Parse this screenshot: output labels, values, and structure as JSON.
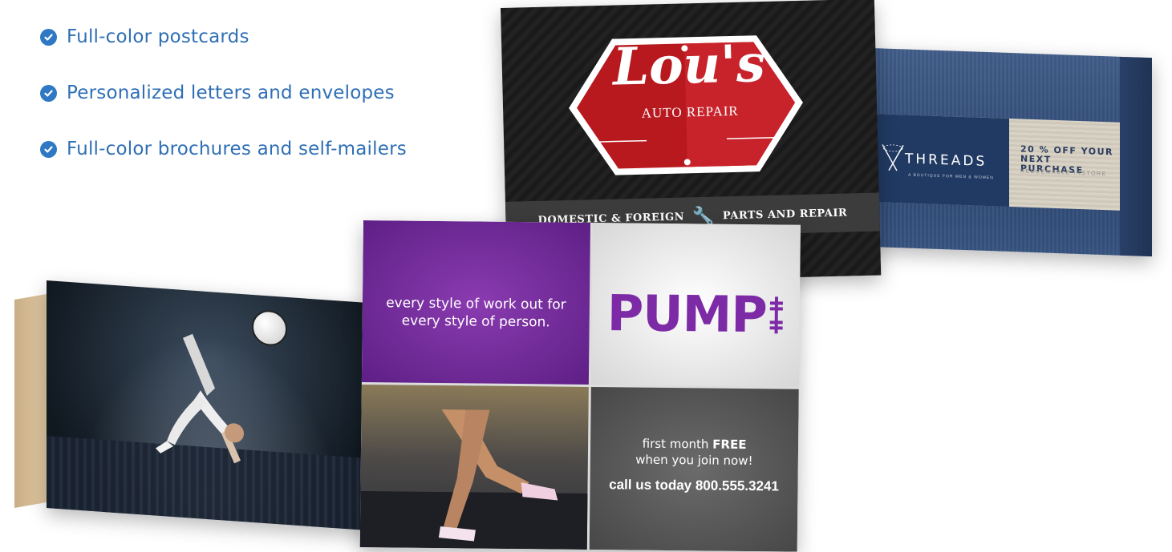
{
  "features": [
    {
      "label": "Full-color postcards",
      "icon": "check-circle-icon"
    },
    {
      "label": "Personalized letters and envelopes",
      "icon": "check-circle-icon"
    },
    {
      "label": "Full-color brochures and self-mailers",
      "icon": "check-circle-icon"
    }
  ],
  "lous": {
    "title": "Lou's",
    "subtitle": "AUTO REPAIR",
    "band_left": "DOMESTIC & FOREIGN",
    "band_right": "PARTS AND REPAIR"
  },
  "threads": {
    "logo": "THREADS",
    "tagline": "A BOUTIQUE FOR MEN & WOMEN",
    "offer": "20 % OFF YOUR NEXT PURCHASE",
    "redeem": "REDEEMABLE INSTORE"
  },
  "pump": {
    "tagline_line1": "every style of work out for",
    "tagline_line2": "every style of person.",
    "logo": "PUMP",
    "promo_prefix": "first month ",
    "promo_bold": "FREE",
    "promo_line2": "when you join now!",
    "phone": "call us today 800.555.3241"
  },
  "colors": {
    "accent": "#2f79c4",
    "pump_purple": "#7d2aa6",
    "lous_red": "#b8191f"
  }
}
